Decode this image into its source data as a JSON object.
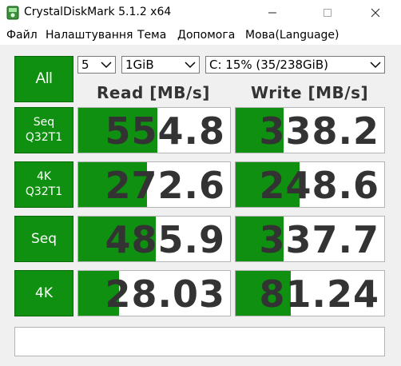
{
  "window": {
    "title": "CrystalDiskMark 5.1.2 x64",
    "icon": "crystaldiskmark-app-icon",
    "minimize_label": "—",
    "maximize_label": "☐",
    "close_label": "✕"
  },
  "menu": [
    "Файл",
    "Налаштування",
    "Тема",
    "Допомога",
    "Мова(Language)"
  ],
  "controls": {
    "all_label": "All",
    "runs": "5",
    "size": "1GiB",
    "drive": "C: 15% (35/238GiB)"
  },
  "headers": {
    "read": "Read [MB/s]",
    "write": "Write [MB/s]"
  },
  "rows": [
    {
      "label_line1": "Seq",
      "label_line2": "Q32T1",
      "read": "554.8",
      "write": "338.2",
      "read_fill": 0.52,
      "write_fill": 0.32
    },
    {
      "label_line1": "4K",
      "label_line2": "Q32T1",
      "read": "272.6",
      "write": "248.6",
      "read_fill": 0.45,
      "write_fill": 0.43
    },
    {
      "label_line1": "Seq",
      "label_line2": "",
      "read": "485.9",
      "write": "337.7",
      "read_fill": 0.51,
      "write_fill": 0.32
    },
    {
      "label_line1": "4K",
      "label_line2": "",
      "read": "28.03",
      "write": "81.24",
      "read_fill": 0.27,
      "write_fill": 0.37
    }
  ],
  "status_text": "",
  "colors": {
    "accent_green": "#109010",
    "value_text": "#333333"
  }
}
